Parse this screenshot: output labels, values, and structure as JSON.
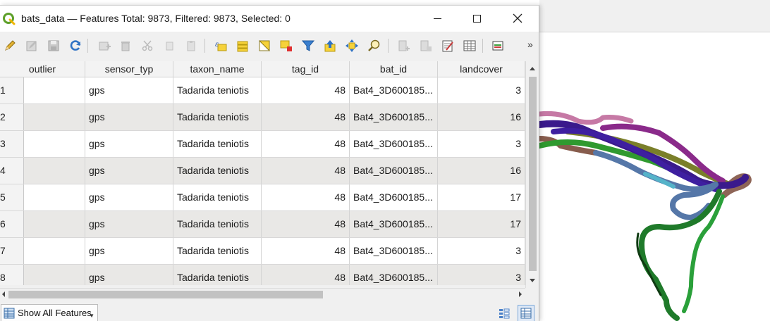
{
  "window": {
    "title": "bats_data — Features Total: 9873, Filtered: 9873, Selected: 0"
  },
  "toolbar": {
    "icons": [
      "pencil-icon",
      "multi-edit-icon",
      "save-icon",
      "refresh-icon",
      "add-feature-icon",
      "delete-icon",
      "cut-icon",
      "copy-icon",
      "paste-icon",
      "expression-select-icon",
      "select-all-icon",
      "invert-selection-icon",
      "deselect-icon",
      "filter-icon",
      "move-top-icon",
      "pan-map-icon",
      "zoom-map-icon",
      "new-field-icon",
      "delete-field-icon",
      "field-calculator-icon",
      "conditional-format-icon",
      "dock-icon"
    ],
    "more_label": "»"
  },
  "table": {
    "columns": [
      "outlier",
      "sensor_typ",
      "taxon_name",
      "tag_id",
      "bat_id",
      "landcover"
    ],
    "rows": [
      {
        "id": "1",
        "outlier": "",
        "sensor_typ": "gps",
        "taxon_name": "Tadarida teniotis",
        "tag_id": "48",
        "bat_id": "Bat4_3D600185...",
        "landcover": "3"
      },
      {
        "id": "2",
        "outlier": "",
        "sensor_typ": "gps",
        "taxon_name": "Tadarida teniotis",
        "tag_id": "48",
        "bat_id": "Bat4_3D600185...",
        "landcover": "16"
      },
      {
        "id": "3",
        "outlier": "",
        "sensor_typ": "gps",
        "taxon_name": "Tadarida teniotis",
        "tag_id": "48",
        "bat_id": "Bat4_3D600185...",
        "landcover": "3"
      },
      {
        "id": "4",
        "outlier": "",
        "sensor_typ": "gps",
        "taxon_name": "Tadarida teniotis",
        "tag_id": "48",
        "bat_id": "Bat4_3D600185...",
        "landcover": "16"
      },
      {
        "id": "5",
        "outlier": "",
        "sensor_typ": "gps",
        "taxon_name": "Tadarida teniotis",
        "tag_id": "48",
        "bat_id": "Bat4_3D600185...",
        "landcover": "17"
      },
      {
        "id": "6",
        "outlier": "",
        "sensor_typ": "gps",
        "taxon_name": "Tadarida teniotis",
        "tag_id": "48",
        "bat_id": "Bat4_3D600185...",
        "landcover": "17"
      },
      {
        "id": "7",
        "outlier": "",
        "sensor_typ": "gps",
        "taxon_name": "Tadarida teniotis",
        "tag_id": "48",
        "bat_id": "Bat4_3D600185...",
        "landcover": "3"
      },
      {
        "id": "8",
        "outlier": "",
        "sensor_typ": "gps",
        "taxon_name": "Tadarida teniotis",
        "tag_id": "48",
        "bat_id": "Bat4_3D600185...",
        "landcover": "3"
      }
    ]
  },
  "footer": {
    "filter_label": "Show All Features"
  },
  "map": {
    "track_colors": [
      "#3a1a8c",
      "#2f9a2f",
      "#8a2a8a",
      "#6f7f2a",
      "#5577a8",
      "#7a4a3a",
      "#55b3c9",
      "#111111"
    ]
  }
}
